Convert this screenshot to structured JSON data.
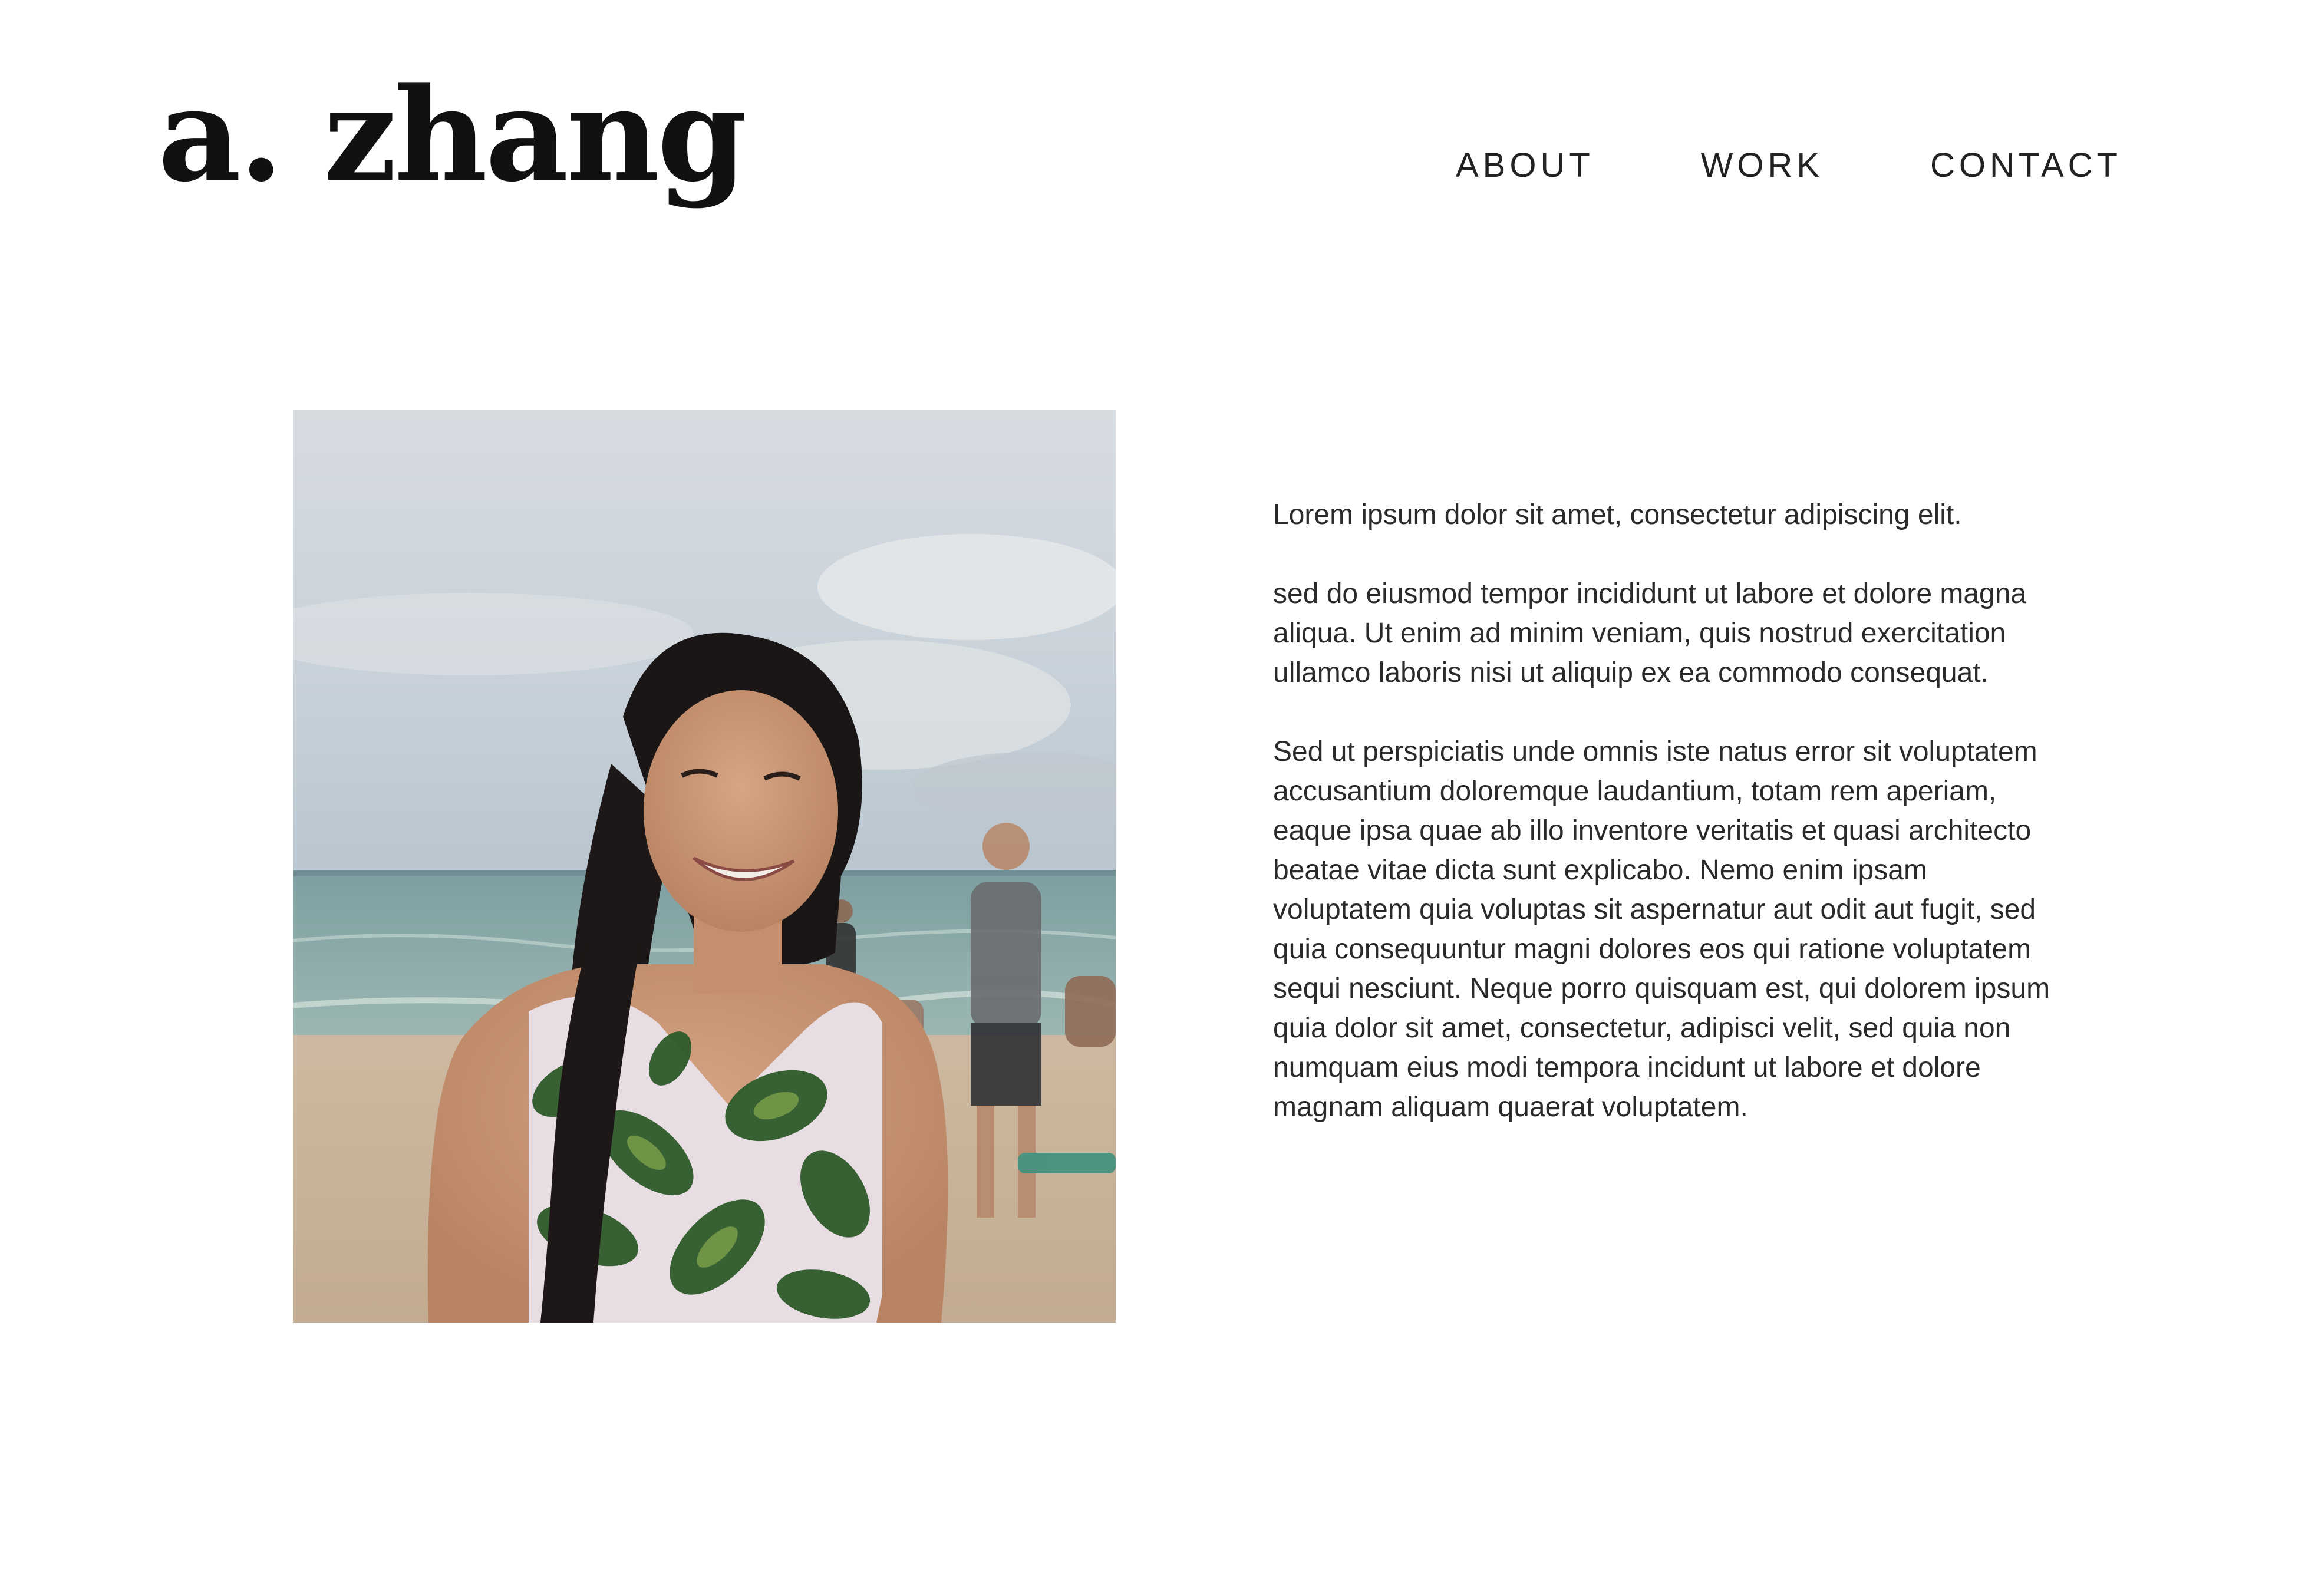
{
  "site": {
    "logo_text": "a. zhang"
  },
  "nav": {
    "items": [
      {
        "label": "ABOUT"
      },
      {
        "label": "WORK"
      },
      {
        "label": "CONTACT"
      }
    ]
  },
  "photo": {
    "alt": "Portrait of a smiling woman with a long braid on a beach"
  },
  "bio": {
    "paragraphs": [
      "Lorem ipsum dolor sit amet, consectetur adipiscing elit.",
      "sed do eiusmod tempor incididunt ut labore et dolore magna aliqua. Ut enim ad minim veniam, quis nostrud exercitation ullamco laboris nisi ut aliquip ex ea commodo consequat.",
      "Sed ut perspiciatis unde omnis iste natus error sit voluptatem accusantium doloremque laudantium, totam rem aperiam, eaque ipsa quae ab illo inventore veritatis et quasi architecto beatae vitae dicta sunt explicabo. Nemo enim ipsam voluptatem quia voluptas sit aspernatur aut odit aut fugit, sed quia consequuntur magni dolores eos qui ratione voluptatem sequi nesciunt. Neque porro quisquam est, qui dolorem ipsum quia dolor sit amet, consectetur, adipisci velit, sed quia non numquam eius modi tempora incidunt ut labore et dolore magnam aliquam quaerat voluptatem."
    ]
  },
  "colors": {
    "background": "#ffffff",
    "text": "#222222",
    "logo": "#111111"
  }
}
